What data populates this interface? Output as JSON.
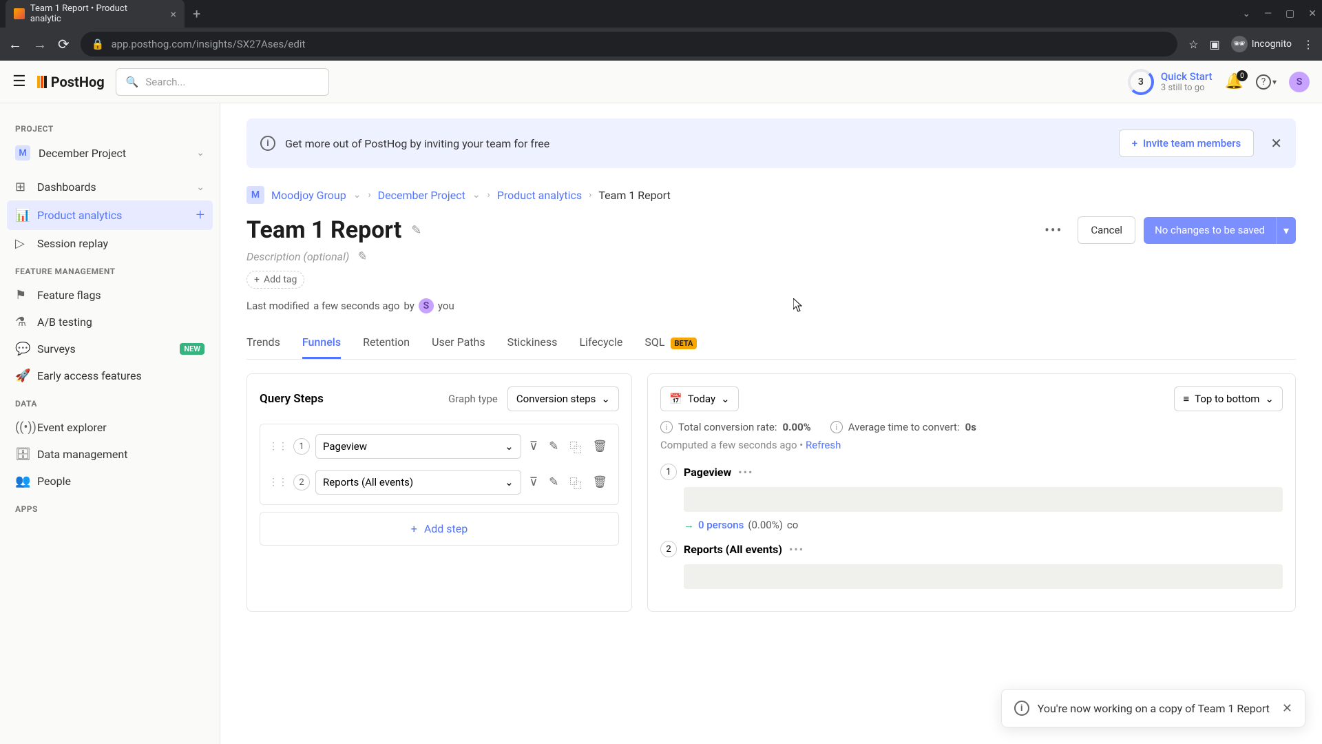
{
  "browser": {
    "tab_title": "Team 1 Report • Product analytic",
    "url": "app.posthog.com/insights/SX27Ases/edit",
    "incognito_label": "Incognito"
  },
  "header": {
    "logo_text": "PostHog",
    "search_placeholder": "Search...",
    "quickstart_title": "Quick Start",
    "quickstart_sub": "3 still to go",
    "quickstart_count": "3",
    "notif_count": "0",
    "avatar_initial": "S"
  },
  "sidebar": {
    "sections": {
      "project": "PROJECT",
      "feature": "FEATURE MANAGEMENT",
      "data": "DATA",
      "apps": "APPS"
    },
    "project_badge": "M",
    "project_name": "December Project",
    "items": {
      "dashboards": "Dashboards",
      "product_analytics": "Product analytics",
      "session_replay": "Session replay",
      "feature_flags": "Feature flags",
      "ab_testing": "A/B testing",
      "surveys": "Surveys",
      "early_access": "Early access features",
      "event_explorer": "Event explorer",
      "data_management": "Data management",
      "people": "People"
    },
    "new_badge": "NEW"
  },
  "banner": {
    "text": "Get more out of PostHog by inviting your team for free",
    "btn": "Invite team members"
  },
  "breadcrumb": {
    "org_badge": "M",
    "org": "Moodjoy Group",
    "project": "December Project",
    "section": "Product analytics",
    "page": "Team 1 Report"
  },
  "page": {
    "title": "Team 1 Report",
    "desc_placeholder": "Description (optional)",
    "add_tag": "Add tag",
    "last_modified_label": "Last modified",
    "last_modified_time": "a few seconds ago",
    "by_label": "by",
    "by_you": "you",
    "by_avatar": "S",
    "more": "•••",
    "cancel": "Cancel",
    "save": "No changes to be saved"
  },
  "tabs": [
    {
      "label": "Trends"
    },
    {
      "label": "Funnels"
    },
    {
      "label": "Retention"
    },
    {
      "label": "User Paths"
    },
    {
      "label": "Stickiness"
    },
    {
      "label": "Lifecycle"
    },
    {
      "label": "SQL",
      "beta": "BETA"
    }
  ],
  "query": {
    "title": "Query Steps",
    "graph_type_label": "Graph type",
    "graph_type_value": "Conversion steps",
    "steps": [
      {
        "num": "1",
        "event": "Pageview"
      },
      {
        "num": "2",
        "event": "Reports (All events)"
      }
    ],
    "add_step": "Add step"
  },
  "results": {
    "date_value": "Today",
    "sort_value": "Top to bottom",
    "conv_label": "Total conversion rate:",
    "conv_value": "0.00%",
    "avg_label": "Average time to convert:",
    "avg_value": "0s",
    "computed_label": "Computed a few seconds ago",
    "refresh": "Refresh",
    "steps": [
      {
        "num": "1",
        "name": "Pageview",
        "persons": "0 persons",
        "pct": "(0.00%)",
        "tail": "co"
      },
      {
        "num": "2",
        "name": "Reports (All events)"
      }
    ]
  },
  "toast": {
    "text": "You're now working on a copy of Team 1 Report"
  }
}
